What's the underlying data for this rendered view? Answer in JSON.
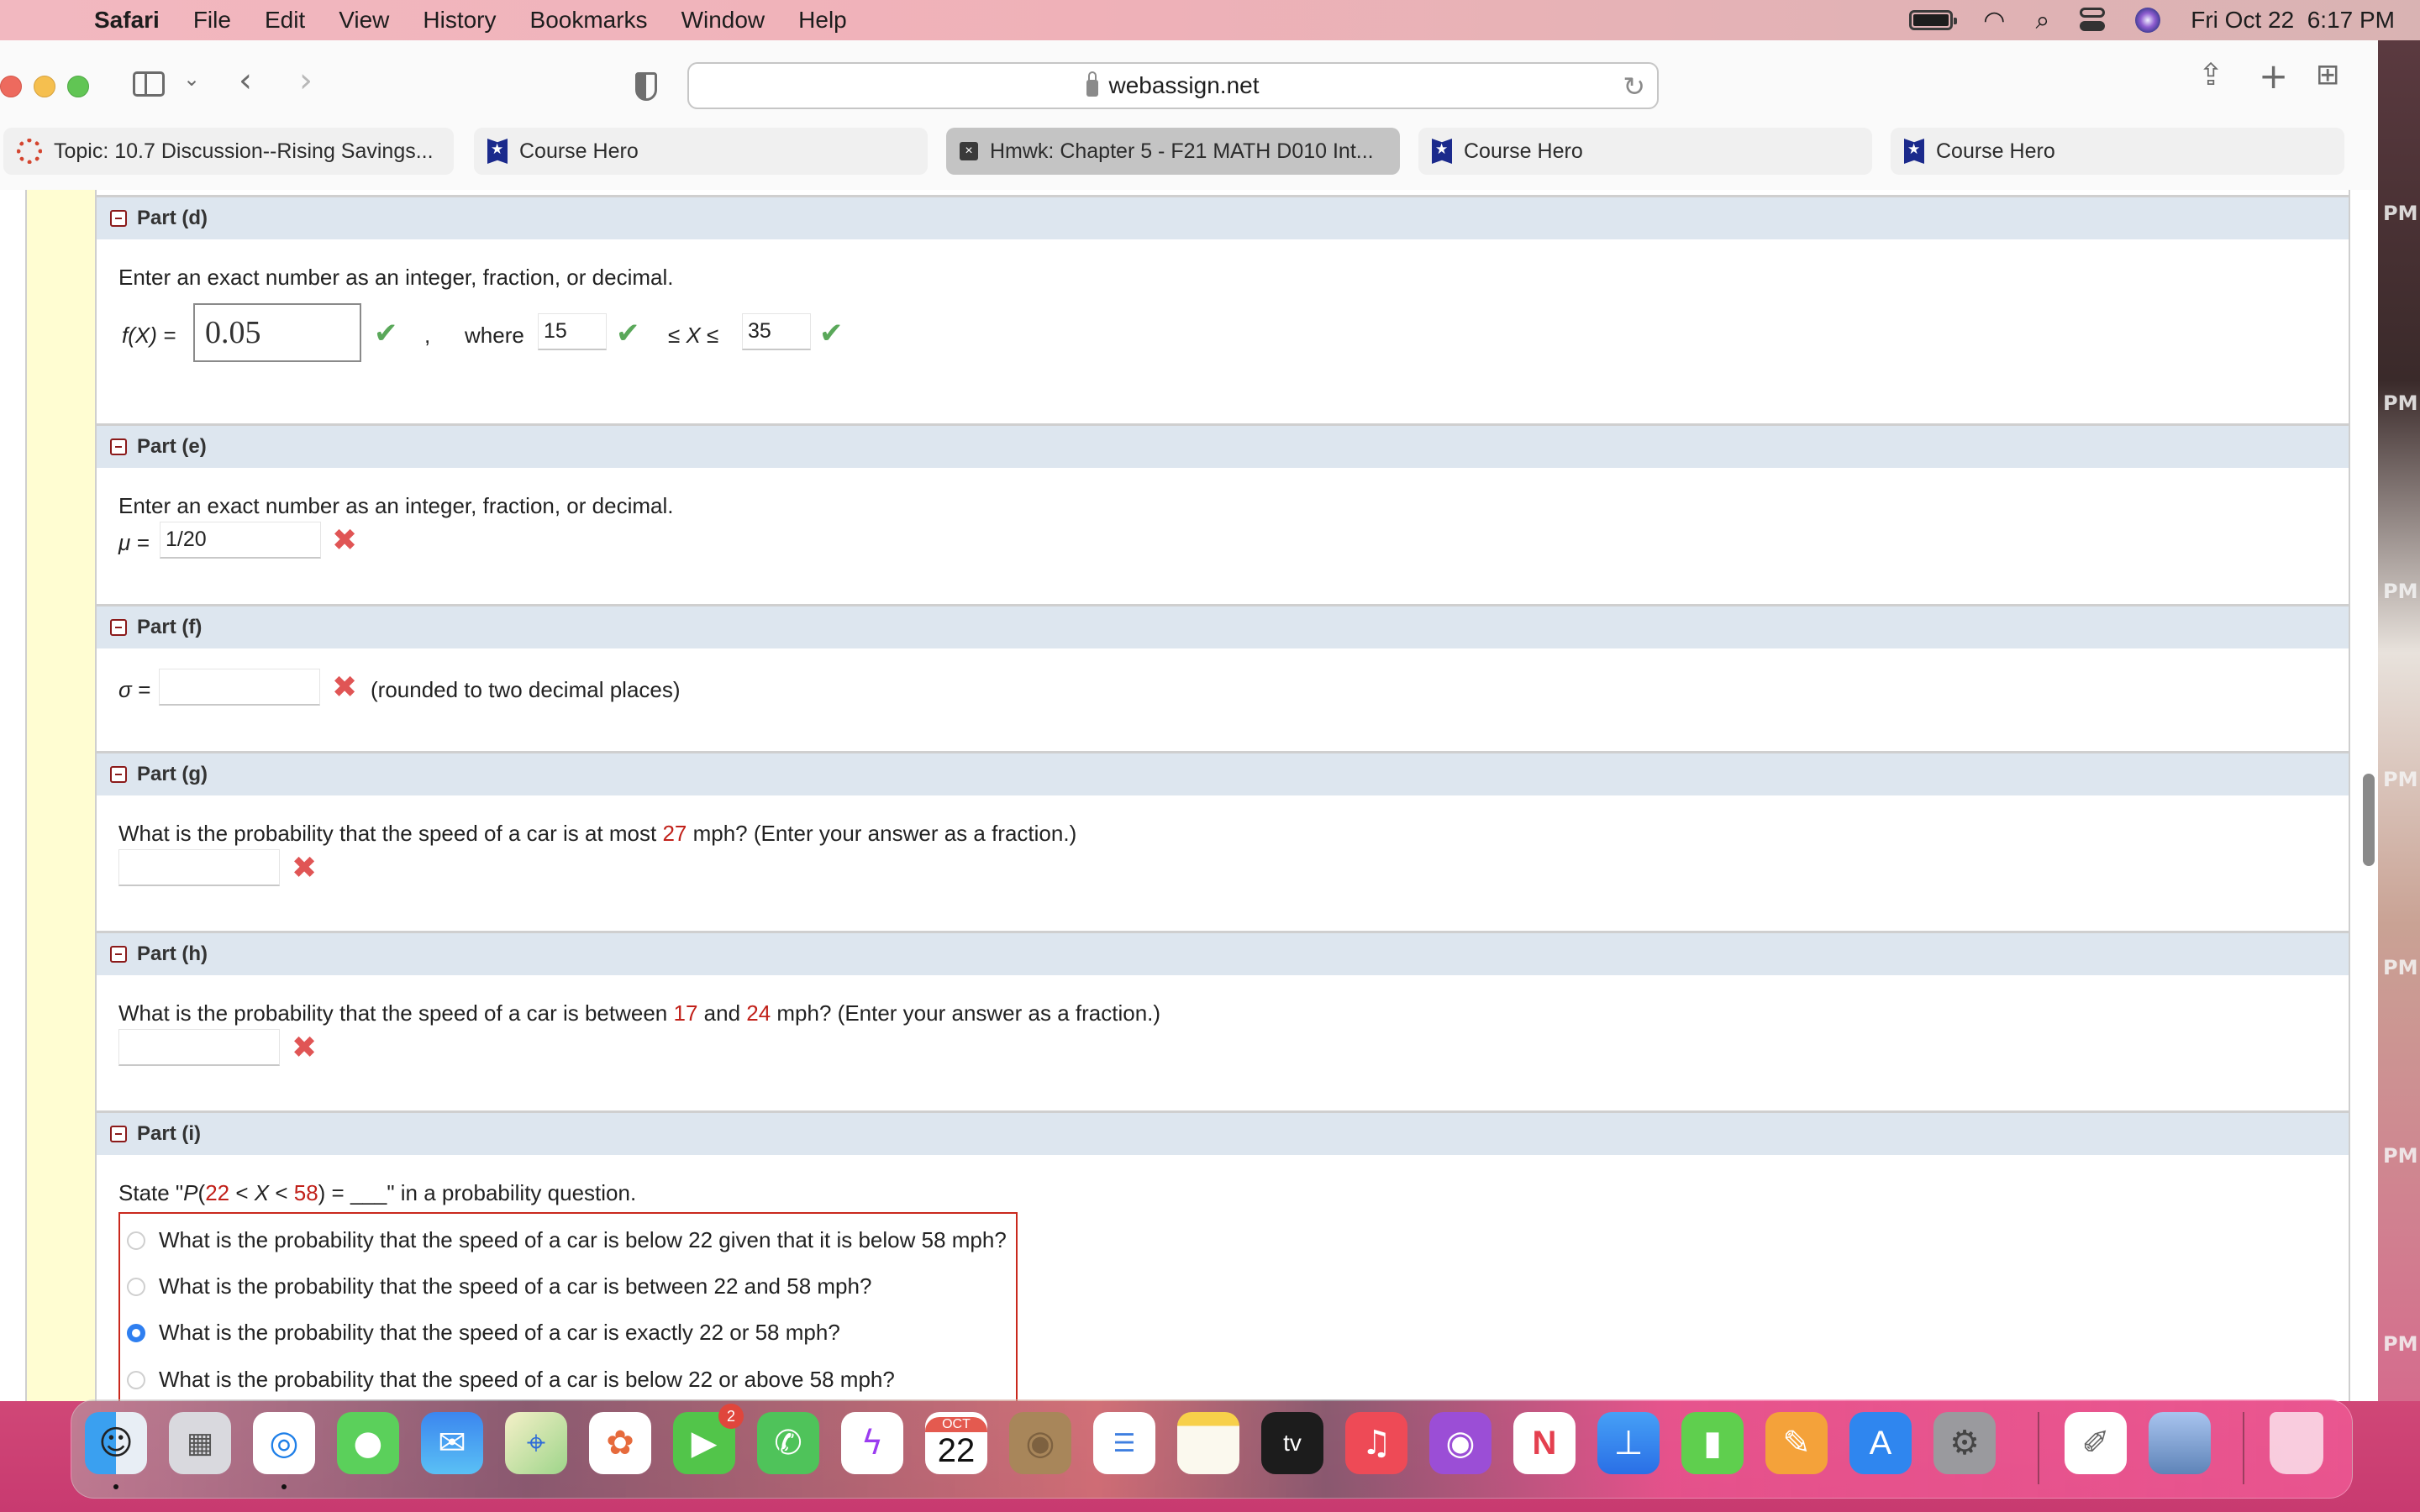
{
  "menubar": {
    "app_name": "Safari",
    "items": [
      "File",
      "Edit",
      "View",
      "History",
      "Bookmarks",
      "Window",
      "Help"
    ],
    "datetime": "Fri Oct 22  6:17 PM"
  },
  "browser": {
    "url": "webassign.net",
    "tabs": [
      {
        "label": "Topic: 10.7 Discussion--Rising Savings...",
        "icon": "canvas-icon",
        "active": false
      },
      {
        "label": "Course Hero",
        "icon": "course-hero-icon",
        "active": false
      },
      {
        "label": "Hmwk: Chapter 5 - F21 MATH D010 Int...",
        "icon": "close-tab-icon",
        "active": true
      },
      {
        "label": "Course Hero",
        "icon": "course-hero-icon",
        "active": false
      },
      {
        "label": "Course Hero",
        "icon": "course-hero-icon",
        "active": false
      }
    ]
  },
  "parts": {
    "d": {
      "title": "Part (d)",
      "instruction": "Enter an exact number as an integer, fraction, or decimal.",
      "fx_label": "f(X) =",
      "fx_value": "0.05",
      "comma": ",",
      "where_label": "where",
      "lower_value": "15",
      "between_label": "≤ X ≤",
      "upper_value": "35",
      "status": [
        "correct",
        "correct",
        "correct"
      ]
    },
    "e": {
      "title": "Part (e)",
      "instruction": "Enter an exact number as an integer, fraction, or decimal.",
      "mu_label": "μ =",
      "mu_value": "1/20",
      "status": "incorrect"
    },
    "f": {
      "title": "Part (f)",
      "sigma_label": "σ =",
      "sigma_value": "",
      "note": "(rounded to two decimal places)",
      "status": "incorrect"
    },
    "g": {
      "title": "Part (g)",
      "question_pre": "What is the probability that the speed of a car is at most ",
      "value": "27",
      "question_post": " mph? (Enter your answer as a fraction.)",
      "answer": "",
      "status": "incorrect"
    },
    "h": {
      "title": "Part (h)",
      "question_pre": "What is the probability that the speed of a car is between ",
      "value1": "17",
      "mid": " and ",
      "value2": "24",
      "question_post": " mph? (Enter your answer as a fraction.)",
      "answer": "",
      "status": "incorrect"
    },
    "i": {
      "title": "Part (i)",
      "prompt_pre": "State \"",
      "prompt_p": "P",
      "prompt_open": "(",
      "prompt_a": "22",
      "prompt_mid1": " < ",
      "prompt_x": "X",
      "prompt_mid2": " < ",
      "prompt_b": "58",
      "prompt_close": ") = ___\" in a probability question.",
      "options": [
        {
          "label": "What is the probability that the speed of a car is below 22 given that it is below 58 mph?",
          "selected": false
        },
        {
          "label": "What is the probability that the speed of a car is between 22 and 58 mph?",
          "selected": false
        },
        {
          "label": "What is the probability that the speed of a car is exactly 22 or 58 mph?",
          "selected": true
        },
        {
          "label": "What is the probability that the speed of a car is below 22 or above 58 mph?",
          "selected": false
        }
      ]
    }
  },
  "dock": {
    "apps": [
      "Finder",
      "Launchpad",
      "Safari",
      "Messages",
      "Mail",
      "Maps",
      "Photos",
      "FaceTime",
      "WhatsApp",
      "Messenger",
      "Calendar",
      "Contacts",
      "Reminders",
      "Notes",
      "TV",
      "Music",
      "Podcasts",
      "News",
      "Keynote",
      "Numbers",
      "Pages",
      "App Store",
      "System Preferences",
      "TextEdit",
      "Preview",
      "Trash"
    ],
    "facetime_badge": "2",
    "calendar_month": "OCT",
    "calendar_day": "22"
  },
  "wallpaper_labels": [
    "PM",
    "PM",
    "PM",
    "PM",
    "PM",
    "PM",
    "PM"
  ],
  "colors": {
    "accent_red": "#c1211a",
    "correct_green": "#5aa85a",
    "incorrect_red": "#e05555",
    "section_header": "#dde6ef",
    "radio_selected": "#2f7ff0"
  }
}
